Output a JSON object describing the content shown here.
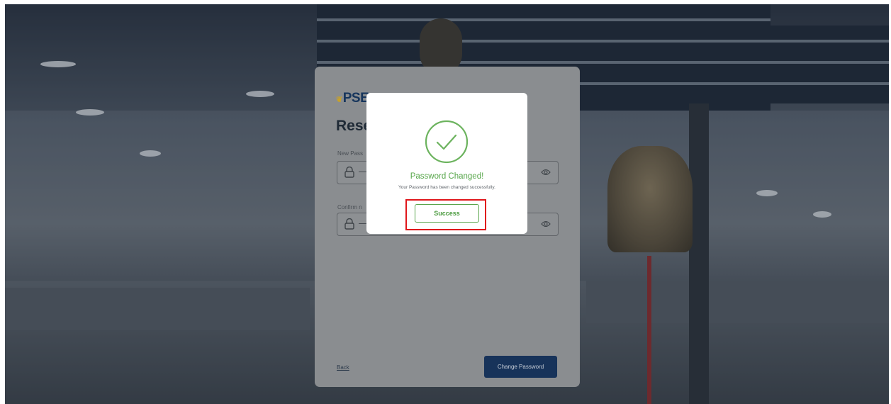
{
  "brand": {
    "logo_text": "PSE"
  },
  "form": {
    "heading": "Rese",
    "new_password_label": "New Pass",
    "new_password_value": "—",
    "confirm_password_label": "Confirm n",
    "confirm_password_value": "—",
    "back_label": "Back",
    "change_password_label": "Change Password"
  },
  "modal": {
    "icon": "check-circle-icon",
    "title": "Password Changed!",
    "message": "Your Password has been changed successfully.",
    "button_label": "Success"
  },
  "colors": {
    "success_green": "#57a64a",
    "primary_navy": "#17335a",
    "highlight_red": "#e0161b"
  }
}
